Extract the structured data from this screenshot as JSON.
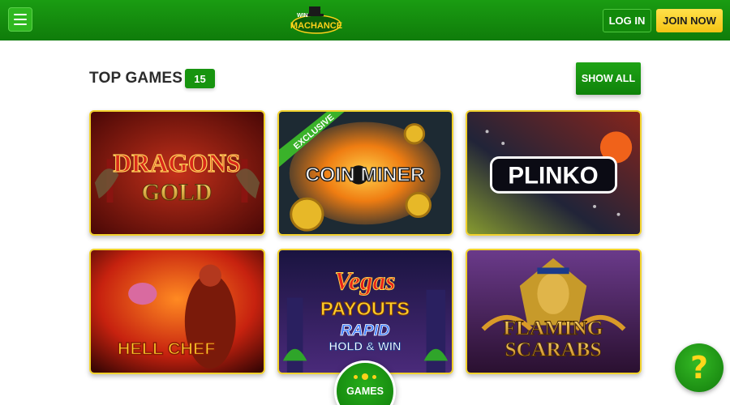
{
  "header": {
    "menu_icon": "hamburger-menu-icon",
    "logo": {
      "line1": "WIN",
      "line2": "MACHANCE"
    },
    "login_label": "LOG IN",
    "join_label": "JOIN NOW"
  },
  "section": {
    "title": "TOP GAMES",
    "count": "15",
    "show_all_label": "SHOW ALL"
  },
  "games": [
    {
      "title_line1": "DRAGONS",
      "title_line2": "GOLD"
    },
    {
      "ribbon": "EXCLUSIVE",
      "title": "COIN MINER"
    },
    {
      "title": "PLINKO"
    },
    {
      "title": "HELL CHEF"
    },
    {
      "title_line1": "Vegas",
      "title_line2": "PAYOUTS",
      "title_line3": "RAPID",
      "title_line4": "HOLD & WIN"
    },
    {
      "title_line1": "FLAMING",
      "title_line2": "SCARABS"
    }
  ],
  "floating": {
    "games_label": "GAMES",
    "help_symbol": "?"
  },
  "colors": {
    "brand_green": "#15900e",
    "accent_yellow": "#f5c414",
    "tile_border": "#f2d22c"
  }
}
